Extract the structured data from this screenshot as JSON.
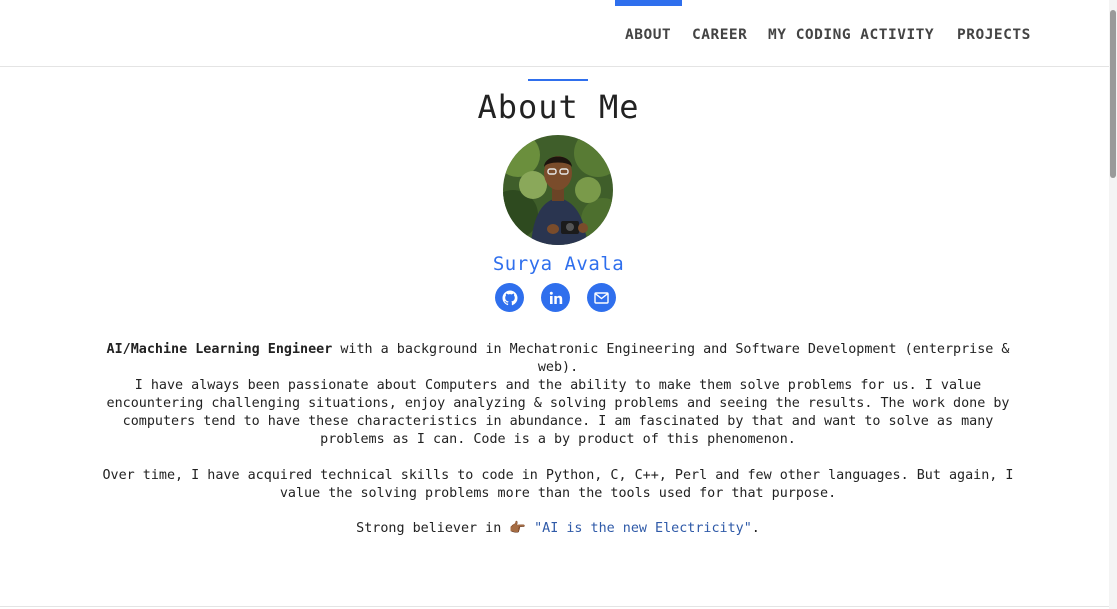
{
  "nav": {
    "items": [
      {
        "label": "ABOUT"
      },
      {
        "label": "CAREER"
      },
      {
        "label": "MY CODING ACTIVITY"
      },
      {
        "label": "PROJECTS"
      }
    ],
    "active": "ABOUT"
  },
  "about": {
    "title": "About Me",
    "name": "Surya Avala",
    "social": [
      {
        "icon": "github-icon"
      },
      {
        "icon": "linkedin-icon"
      },
      {
        "icon": "mail-icon"
      }
    ],
    "intro_bold": "AI/Machine Learning Engineer",
    "intro_rest": " with a background in Mechatronic Engineering and Software Development (enterprise & web).",
    "paragraph2": "I have always been passionate about Computers and the ability to make them solve problems for us. I value encountering challenging situations, enjoy analyzing & solving problems and seeing the results. The work done by computers tend to have these characteristics in abundance. I am fascinated by that and want to solve as many problems as I can. Code is a by product of this phenomenon.",
    "paragraph3": "Over time, I have acquired technical skills to code in Python, C, C++, Perl and few other languages. But again, I value the solving problems more than the tools used for that purpose.",
    "believer_prefix": "Strong believer in ",
    "pointing_emoji": "👉🏾",
    "quote": "\"AI is the new Electricity\"",
    "believer_suffix": "."
  },
  "colors": {
    "accent": "#2f6fed",
    "link": "#2f5aa8"
  }
}
